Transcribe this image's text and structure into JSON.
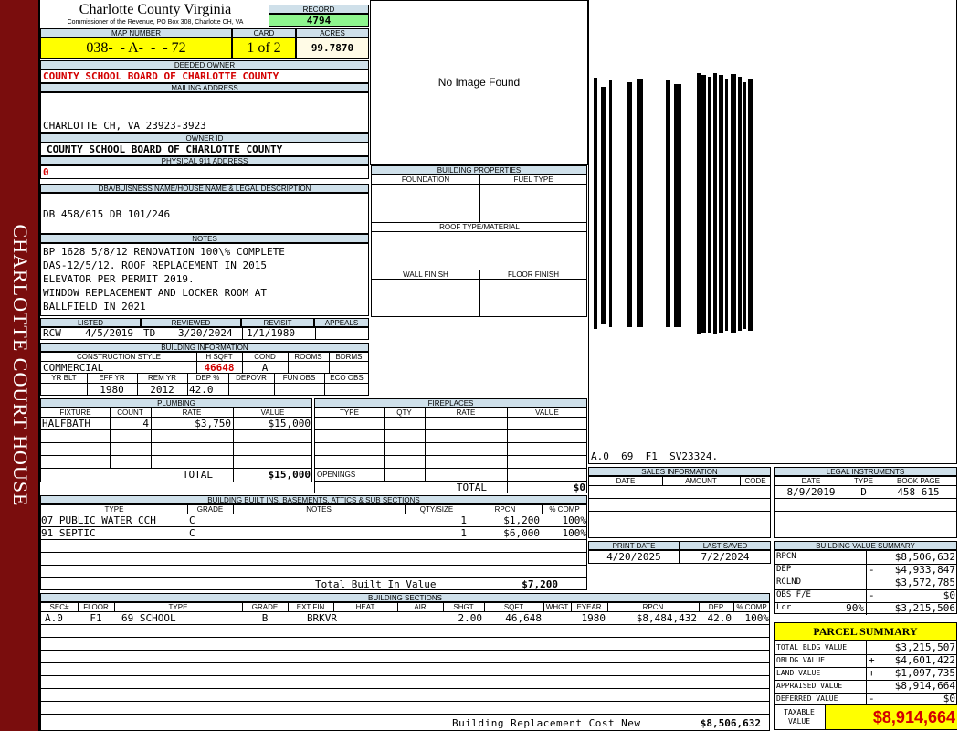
{
  "sidebar": {
    "title": "CHARLOTTE COURT HOUSE"
  },
  "header": {
    "county": "Charlotte County Virginia",
    "subtitle": "Commissioner of the Revenue, PO Box 308, Charlotte CH, VA",
    "record_label": "RECORD",
    "record_value": "4794",
    "map_label": "MAP NUMBER",
    "map_value": "038-  - A-  -  - 72",
    "card_label": "CARD",
    "card_value": "1 of 2",
    "acres_label": "ACRES",
    "acres_value": "99.7870"
  },
  "owner": {
    "deeded_label": "DEEDED OWNER",
    "deeded_value": "COUNTY SCHOOL BOARD OF CHARLOTTE COUNTY",
    "mailing_label": "MAILING ADDRESS",
    "mailing_value": "CHARLOTTE CH, VA 23923-3923",
    "owner_id_label": "OWNER ID",
    "owner_id_value": "COUNTY SCHOOL BOARD OF CHARLOTTE COUNTY",
    "physical_label": "PHYSICAL 911 ADDRESS",
    "physical_value": "0"
  },
  "photo": {
    "text": "No Image Found"
  },
  "legal": {
    "label": "DBA/BUISNESS NAME/HOUSE NAME & LEGAL DESCRIPTION",
    "value": "DB 458/615 DB 101/246"
  },
  "notes": {
    "label": "NOTES",
    "lines": [
      "BP 1628 5/8/12 RENOVATION 100\\% COMPLETE",
      "DAS-12/5/12. ROOF REPLACEMENT IN 2015",
      "ELEVATOR PER PERMIT 2019.",
      "WINDOW REPLACEMENT AND LOCKER ROOM AT",
      "BALLFIELD IN 2021"
    ]
  },
  "building_properties": {
    "label": "BUILDING PROPERTIES",
    "foundation": "FOUNDATION",
    "fuel": "FUEL TYPE",
    "roof": "ROOF TYPE/MATERIAL",
    "wall": "WALL FINISH",
    "floor": "FLOOR FINISH"
  },
  "sketch": {
    "caption": "A.0  69  F1  SV23324."
  },
  "dates": {
    "listed_label": "LISTED",
    "listed_by": "RCW",
    "listed_date": "4/5/2019",
    "reviewed_label": "REVIEWED",
    "reviewed_by": "TD",
    "reviewed_date": "3/20/2024",
    "revisit_label": "REVISIT",
    "revisit_date": "1/1/1980",
    "appeals_label": "APPEALS"
  },
  "building_info": {
    "label": "BUILDING INFORMATION",
    "construction_label": "CONSTRUCTION STYLE",
    "construction_value": "COMMERCIAL",
    "hsqft_label": "H SQFT",
    "hsqft_value": "46648",
    "cond_label": "COND",
    "cond_value": "A",
    "rooms_label": "ROOMS",
    "bdrms_label": "BDRMS",
    "yrblt_label": "YR BLT",
    "effyr_label": "EFF YR",
    "effyr_value": "1980",
    "remyr_label": "REM YR",
    "remyr_value": "2012",
    "dep_label": "DEP %",
    "dep_value": "42.0",
    "depovr_label": "DEPOVR",
    "funobs_label": "FUN OBS",
    "ecoobs_label": "ECO OBS"
  },
  "plumbing": {
    "label": "PLUMBING",
    "headers": [
      "FIXTURE",
      "COUNT",
      "RATE",
      "VALUE"
    ],
    "rows": [
      [
        "HALFBATH",
        "4",
        "$3,750",
        "$15,000"
      ]
    ],
    "total_label": "TOTAL",
    "total_value": "$15,000"
  },
  "fireplaces": {
    "label": "FIREPLACES",
    "headers": [
      "TYPE",
      "QTY",
      "RATE",
      "VALUE"
    ],
    "openings_label": "OPENINGS",
    "total_label": "TOTAL",
    "total_value": "$0"
  },
  "builtins": {
    "label": "BUILDING BUILT INS, BASEMENTS, ATTICS & SUB SECTIONS",
    "headers": [
      "TYPE",
      "GRADE",
      "NOTES",
      "QTY/SIZE",
      "RPCN",
      "% COMP"
    ],
    "rows": [
      [
        "07 PUBLIC WATER CCH",
        "C",
        "",
        "1",
        "$1,200",
        "100%"
      ],
      [
        "91 SEPTIC",
        "C",
        "",
        "1",
        "$6,000",
        "100%"
      ]
    ],
    "total_label": "Total Built In Value",
    "total_value": "$7,200"
  },
  "sections": {
    "label": "BUILDING SECTIONS",
    "headers": [
      "SEC#",
      "FLOOR",
      "TYPE",
      "GRADE",
      "EXT FIN",
      "HEAT",
      "AIR",
      "SHGT",
      "SQFT",
      "WHGT",
      "EYEAR",
      "RPCN",
      "DEP",
      "% COMP"
    ],
    "rows": [
      [
        "A.0",
        "F1",
        "69 SCHOOL",
        "B",
        "BRKVR",
        "",
        "",
        "2.00",
        "46,648",
        "",
        "1980",
        "$8,484,432",
        "42.0",
        "100%"
      ]
    ],
    "replacement_label": "Building Replacement Cost New",
    "replacement_value": "$8,506,632"
  },
  "sales": {
    "label": "SALES INFORMATION",
    "headers": [
      "DATE",
      "AMOUNT",
      "CODE"
    ]
  },
  "legal_instruments": {
    "label": "LEGAL INSTRUMENTS",
    "headers": [
      "DATE",
      "TYPE",
      "BOOK PAGE"
    ],
    "rows": [
      [
        "8/9/2019",
        "D",
        "458 615"
      ]
    ]
  },
  "print": {
    "print_label": "PRINT DATE",
    "print_value": "4/20/2025",
    "saved_label": "LAST SAVED",
    "saved_value": "7/2/2024"
  },
  "value_summary": {
    "label": "BUILDING VALUE SUMMARY",
    "rows": [
      {
        "label": "RPCN",
        "sign": "",
        "value": "$8,506,632"
      },
      {
        "label": "DEP",
        "sign": "-",
        "value": "$4,933,847"
      },
      {
        "label": "RCLND",
        "sign": "",
        "value": "$3,572,785"
      },
      {
        "label": "OBS F/E",
        "sign": "-",
        "value": "$0"
      },
      {
        "label": "Lcr",
        "pct": "90%",
        "sign": "",
        "value": "$3,215,506"
      }
    ]
  },
  "parcel": {
    "label": "PARCEL SUMMARY",
    "rows": [
      {
        "label": "TOTAL BLDG VALUE",
        "sign": "",
        "value": "$3,215,507"
      },
      {
        "label": "OBLDG VALUE",
        "sign": "+",
        "value": "$4,601,422"
      },
      {
        "label": "LAND VALUE",
        "sign": "+",
        "value": "$1,097,735"
      },
      {
        "label": "APPRAISED VALUE",
        "sign": "",
        "value": "$8,914,664"
      },
      {
        "label": "DEFERRED VALUE",
        "sign": "-",
        "value": "$0"
      }
    ],
    "taxable_label": "TAXABLE VALUE",
    "taxable_value": "$8,914,664"
  },
  "colors": {
    "sidebar": "#7a0d0d",
    "header_band": "#cfe0ea",
    "highlight": "#ffff00",
    "record": "#8ef58e",
    "accent_red": "#d30000"
  }
}
